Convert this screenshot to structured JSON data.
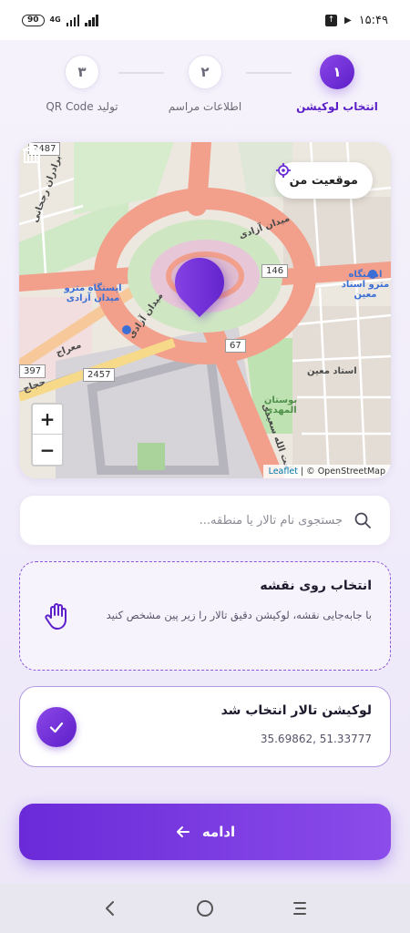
{
  "status_bar": {
    "battery": "90",
    "network": "4G",
    "time": "۱۵:۴۹"
  },
  "stepper": {
    "steps": [
      {
        "number": "۱",
        "label": "انتخاب لوکیشن",
        "active": true
      },
      {
        "number": "۲",
        "label": "اطلاعات مراسم",
        "active": false
      },
      {
        "number": "۳",
        "label": "تولید QR Code",
        "active": false
      }
    ]
  },
  "map": {
    "my_location_label": "موقعیت من",
    "zoom_in": "+",
    "zoom_out": "−",
    "attribution_leaflet": "Leaflet",
    "attribution_rest": " | © OpenStreetMap",
    "labels": {
      "street1": "برادران رجحانی",
      "square": "میدان آزادی",
      "metro_left": "ایستگاه مترو میدان آزادی",
      "square2": "میدان آزادی",
      "metro_right": "ایستگاه مترو استاد معین",
      "ostad": "استاد معین",
      "park": "بوستان المهدی",
      "meraj": "معراج",
      "hajaj": "حجاج",
      "ayatollah": "آیت الله سعیدی"
    },
    "shields": {
      "s2487": "2487",
      "s146": "146",
      "s67": "67",
      "s397": "397",
      "s2457": "2457"
    }
  },
  "search": {
    "placeholder": "جستجوی نام تالار یا منطقه..."
  },
  "hint_card": {
    "title": "انتخاب روی نقشه",
    "description": "با جابه‌جایی نقشه، لوکیشن دقیق تالار را زیر پین مشخص کنید"
  },
  "selected_card": {
    "title": "لوکیشن تالار انتخاب شد",
    "coords": "35.69862, 51.33777"
  },
  "continue_button": {
    "label": "ادامه"
  },
  "colors": {
    "accent": "#6a2ad8",
    "accent_light": "#8b4cea"
  }
}
